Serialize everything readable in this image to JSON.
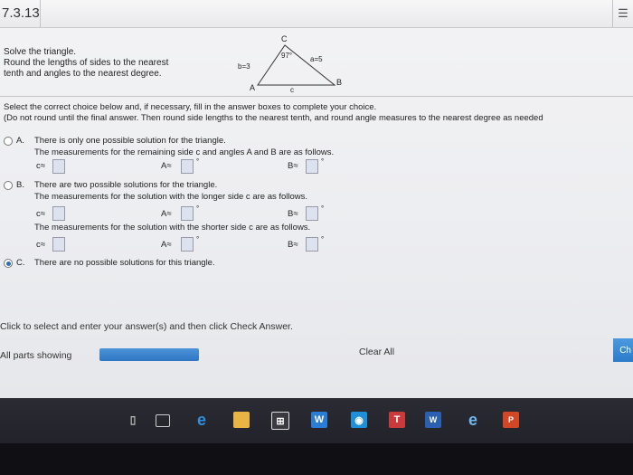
{
  "header": {
    "section": "7.3.13",
    "menu_icon": "list-icon"
  },
  "problem": {
    "line1": "Solve the triangle.",
    "line2": "Round the lengths of sides to the nearest",
    "line3": "tenth and angles to the nearest degree."
  },
  "triangle": {
    "vertex_c": "C",
    "vertex_a": "A",
    "vertex_b": "B",
    "angle_c": "97°",
    "side_b": "b=3",
    "side_a": "a=5",
    "side_c": "c"
  },
  "instructions": {
    "line1": "Select the correct choice below and, if necessary, fill in the answer boxes to complete your choice.",
    "line2": "(Do not round until the final answer. Then round side lengths to the nearest tenth, and round angle measures to the nearest degree as needed"
  },
  "choices": {
    "a": {
      "letter": "A.",
      "text": "There is only one possible solution for the triangle.",
      "sub": "The measurements for the remaining side c and angles A and B are as follows.",
      "selected": false
    },
    "b": {
      "letter": "B.",
      "text": "There are two possible solutions for the triangle.",
      "sub1": "The measurements for the solution with the longer side c are as follows.",
      "sub2": "The measurements for the solution with the shorter side c are as follows.",
      "selected": false
    },
    "c": {
      "letter": "C.",
      "text": "There are no possible solutions for this triangle.",
      "selected": true
    }
  },
  "labels": {
    "c_approx": "c≈",
    "A_approx": "A≈",
    "B_approx": "B≈",
    "degree": "°"
  },
  "footer": {
    "hint": "Click to select and enter your answer(s) and then click Check Answer.",
    "parts_showing": "All parts showing",
    "clear_all": "Clear All",
    "check": "Ch"
  },
  "taskbar": {
    "icons": [
      "microphone-icon",
      "task-view-icon",
      "edge-icon",
      "file-explorer-icon",
      "store-icon",
      "word-icon",
      "app-icon",
      "teams-icon",
      "word-doc-icon",
      "ie-icon",
      "powerpoint-icon"
    ]
  },
  "colors": {
    "accent": "#2f76c4",
    "answer_box": "#dde3ee"
  }
}
